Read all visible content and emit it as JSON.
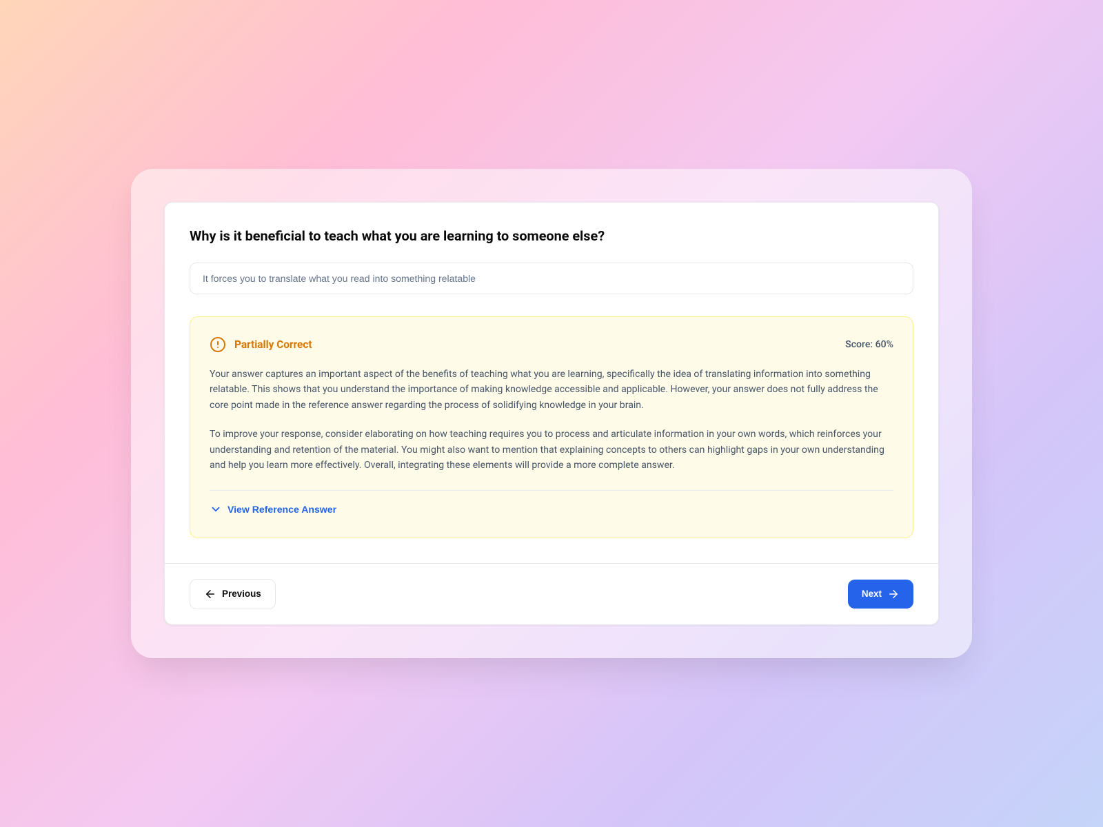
{
  "question": "Why is it beneficial to teach what you are learning to someone else?",
  "user_answer": "It forces you to translate what you read into something relatable",
  "feedback": {
    "status_title": "Partially Correct",
    "score_text": "Score: 60%",
    "paragraphs": [
      "Your answer captures an important aspect of the benefits of teaching what you are learning, specifically the idea of translating information into something relatable. This shows that you understand the importance of making knowledge accessible and applicable. However, your answer does not fully address the core point made in the reference answer regarding the process of solidifying knowledge in your brain.",
      "To improve your response, consider elaborating on how teaching requires you to process and articulate information in your own words, which reinforces your understanding and retention of the material. You might also want to mention that explaining concepts to others can highlight gaps in your own understanding and help you learn more effectively. Overall, integrating these elements will provide a more complete answer."
    ],
    "reference_link": "View Reference Answer"
  },
  "nav": {
    "previous": "Previous",
    "next": "Next"
  },
  "colors": {
    "accent_amber": "#d97706",
    "accent_blue": "#2563eb"
  }
}
